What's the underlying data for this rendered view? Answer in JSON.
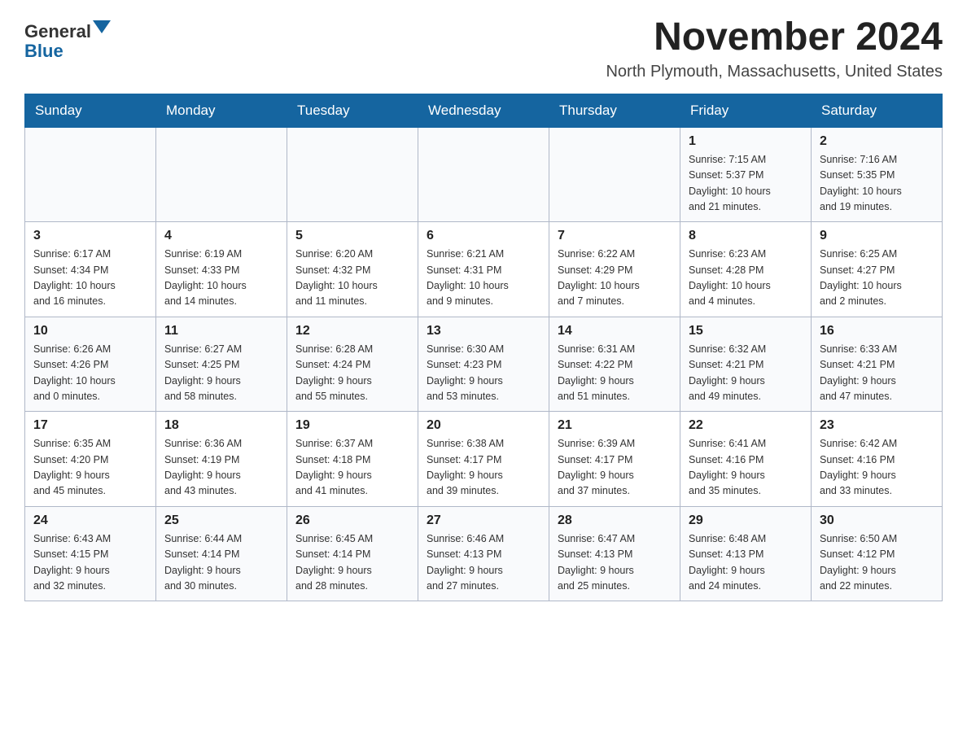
{
  "header": {
    "logo_general": "General",
    "logo_blue": "Blue",
    "month_title": "November 2024",
    "location": "North Plymouth, Massachusetts, United States"
  },
  "calendar": {
    "days_of_week": [
      "Sunday",
      "Monday",
      "Tuesday",
      "Wednesday",
      "Thursday",
      "Friday",
      "Saturday"
    ],
    "weeks": [
      [
        {
          "day": "",
          "info": ""
        },
        {
          "day": "",
          "info": ""
        },
        {
          "day": "",
          "info": ""
        },
        {
          "day": "",
          "info": ""
        },
        {
          "day": "",
          "info": ""
        },
        {
          "day": "1",
          "info": "Sunrise: 7:15 AM\nSunset: 5:37 PM\nDaylight: 10 hours\nand 21 minutes."
        },
        {
          "day": "2",
          "info": "Sunrise: 7:16 AM\nSunset: 5:35 PM\nDaylight: 10 hours\nand 19 minutes."
        }
      ],
      [
        {
          "day": "3",
          "info": "Sunrise: 6:17 AM\nSunset: 4:34 PM\nDaylight: 10 hours\nand 16 minutes."
        },
        {
          "day": "4",
          "info": "Sunrise: 6:19 AM\nSunset: 4:33 PM\nDaylight: 10 hours\nand 14 minutes."
        },
        {
          "day": "5",
          "info": "Sunrise: 6:20 AM\nSunset: 4:32 PM\nDaylight: 10 hours\nand 11 minutes."
        },
        {
          "day": "6",
          "info": "Sunrise: 6:21 AM\nSunset: 4:31 PM\nDaylight: 10 hours\nand 9 minutes."
        },
        {
          "day": "7",
          "info": "Sunrise: 6:22 AM\nSunset: 4:29 PM\nDaylight: 10 hours\nand 7 minutes."
        },
        {
          "day": "8",
          "info": "Sunrise: 6:23 AM\nSunset: 4:28 PM\nDaylight: 10 hours\nand 4 minutes."
        },
        {
          "day": "9",
          "info": "Sunrise: 6:25 AM\nSunset: 4:27 PM\nDaylight: 10 hours\nand 2 minutes."
        }
      ],
      [
        {
          "day": "10",
          "info": "Sunrise: 6:26 AM\nSunset: 4:26 PM\nDaylight: 10 hours\nand 0 minutes."
        },
        {
          "day": "11",
          "info": "Sunrise: 6:27 AM\nSunset: 4:25 PM\nDaylight: 9 hours\nand 58 minutes."
        },
        {
          "day": "12",
          "info": "Sunrise: 6:28 AM\nSunset: 4:24 PM\nDaylight: 9 hours\nand 55 minutes."
        },
        {
          "day": "13",
          "info": "Sunrise: 6:30 AM\nSunset: 4:23 PM\nDaylight: 9 hours\nand 53 minutes."
        },
        {
          "day": "14",
          "info": "Sunrise: 6:31 AM\nSunset: 4:22 PM\nDaylight: 9 hours\nand 51 minutes."
        },
        {
          "day": "15",
          "info": "Sunrise: 6:32 AM\nSunset: 4:21 PM\nDaylight: 9 hours\nand 49 minutes."
        },
        {
          "day": "16",
          "info": "Sunrise: 6:33 AM\nSunset: 4:21 PM\nDaylight: 9 hours\nand 47 minutes."
        }
      ],
      [
        {
          "day": "17",
          "info": "Sunrise: 6:35 AM\nSunset: 4:20 PM\nDaylight: 9 hours\nand 45 minutes."
        },
        {
          "day": "18",
          "info": "Sunrise: 6:36 AM\nSunset: 4:19 PM\nDaylight: 9 hours\nand 43 minutes."
        },
        {
          "day": "19",
          "info": "Sunrise: 6:37 AM\nSunset: 4:18 PM\nDaylight: 9 hours\nand 41 minutes."
        },
        {
          "day": "20",
          "info": "Sunrise: 6:38 AM\nSunset: 4:17 PM\nDaylight: 9 hours\nand 39 minutes."
        },
        {
          "day": "21",
          "info": "Sunrise: 6:39 AM\nSunset: 4:17 PM\nDaylight: 9 hours\nand 37 minutes."
        },
        {
          "day": "22",
          "info": "Sunrise: 6:41 AM\nSunset: 4:16 PM\nDaylight: 9 hours\nand 35 minutes."
        },
        {
          "day": "23",
          "info": "Sunrise: 6:42 AM\nSunset: 4:16 PM\nDaylight: 9 hours\nand 33 minutes."
        }
      ],
      [
        {
          "day": "24",
          "info": "Sunrise: 6:43 AM\nSunset: 4:15 PM\nDaylight: 9 hours\nand 32 minutes."
        },
        {
          "day": "25",
          "info": "Sunrise: 6:44 AM\nSunset: 4:14 PM\nDaylight: 9 hours\nand 30 minutes."
        },
        {
          "day": "26",
          "info": "Sunrise: 6:45 AM\nSunset: 4:14 PM\nDaylight: 9 hours\nand 28 minutes."
        },
        {
          "day": "27",
          "info": "Sunrise: 6:46 AM\nSunset: 4:13 PM\nDaylight: 9 hours\nand 27 minutes."
        },
        {
          "day": "28",
          "info": "Sunrise: 6:47 AM\nSunset: 4:13 PM\nDaylight: 9 hours\nand 25 minutes."
        },
        {
          "day": "29",
          "info": "Sunrise: 6:48 AM\nSunset: 4:13 PM\nDaylight: 9 hours\nand 24 minutes."
        },
        {
          "day": "30",
          "info": "Sunrise: 6:50 AM\nSunset: 4:12 PM\nDaylight: 9 hours\nand 22 minutes."
        }
      ]
    ]
  }
}
